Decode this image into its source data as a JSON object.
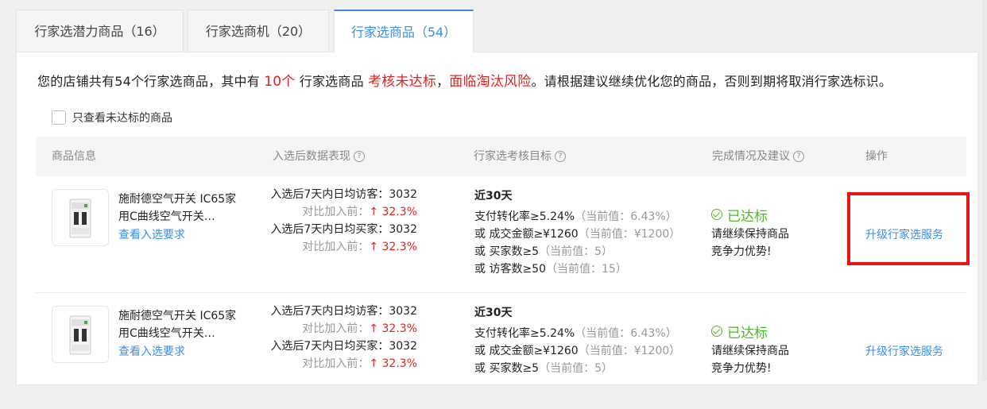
{
  "tabs": [
    {
      "label": "行家选潜力商品（16）",
      "active": false
    },
    {
      "label": "行家选商机（20）",
      "active": false
    },
    {
      "label": "行家选商品（54）",
      "active": true
    }
  ],
  "notice": {
    "part1": "您的店铺共有54个行家选商品，其中有 ",
    "count": "10个",
    "part2": " 行家选商品 ",
    "warn1": "考核未达标",
    "sep": "，",
    "warn2": "面临淘汰风险",
    "part3": "。请根据建议继续优化您的商品，否则到期将取消行家选标识。"
  },
  "filter": {
    "label": "只查看未达标的商品",
    "checked": false
  },
  "columns": {
    "product": "商品信息",
    "performance": "入选后数据表现",
    "target": "行家选考核目标",
    "status": "完成情况及建议",
    "action": "操作"
  },
  "rows": [
    {
      "product_name": "施耐德空气开关 IC65家用C曲线空气开关…",
      "product_link": "查看入选要求",
      "visitors_label": "入选后7天内日均访客：",
      "visitors_value": "3032",
      "visitors_cmp": "对比加入前：",
      "visitors_change": "↑ 32.3%",
      "buyers_label": "入选后7天内日均买家：",
      "buyers_value": "3032",
      "buyers_cmp": "对比加入前：",
      "buyers_change": "↑ 32.3%",
      "target_period": "近30天",
      "t1": "支付转化率≥5.24%",
      "t1_cur": "（当前值：6.43%）",
      "t2": "或 成交金额≥¥1260",
      "t2_cur": "（当前值：¥1200）",
      "t3": "或 买家数≥5",
      "t3_cur": "（当前值：5）",
      "t4": "或 访客数≥50",
      "t4_cur": "（当前值：15）",
      "status": "已达标",
      "advice1": "请继续保持商品",
      "advice2": "竞争力优势!",
      "action": "升级行家选服务"
    },
    {
      "product_name": "施耐德空气开关 IC65家用C曲线空气开关…",
      "product_link": "查看入选要求",
      "visitors_label": "入选后7天内日均访客：",
      "visitors_value": "3032",
      "visitors_cmp": "对比加入前：",
      "visitors_change": "↑ 32.3%",
      "buyers_label": "入选后7天内日均买家：",
      "buyers_value": "3032",
      "buyers_cmp": "对比加入前：",
      "buyers_change": "↑ 32.3%",
      "target_period": "近30天",
      "t1": "支付转化率≥5.24%",
      "t1_cur": "（当前值：6.43%）",
      "t2": "或 成交金额≥¥1260",
      "t2_cur": "（当前值：¥1200）",
      "t3": "或 买家数≥5",
      "t3_cur": "（当前值：5）",
      "status": "已达标",
      "advice1": "请继续保持商品",
      "advice2": "竞争力优势!",
      "action": "升级行家选服务"
    }
  ],
  "colors": {
    "accent": "#3a8ee6",
    "warn": "#e0211d",
    "success": "#52b42c",
    "highlight": "#e81417"
  }
}
